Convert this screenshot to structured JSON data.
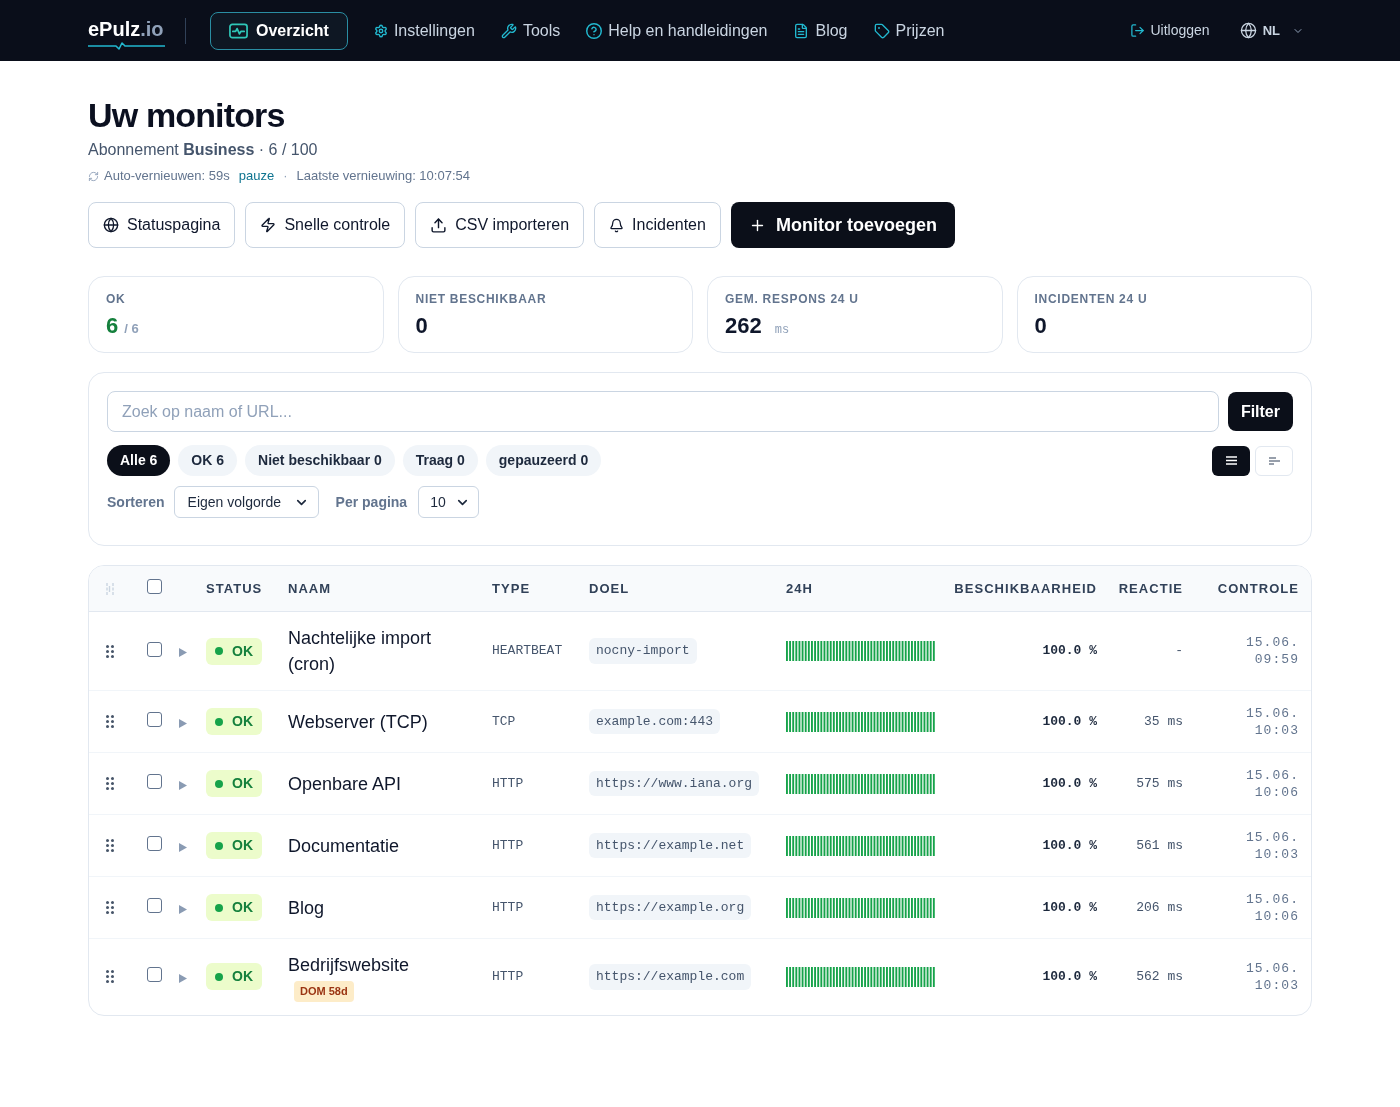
{
  "nav": {
    "logo": {
      "name": "ePulz",
      "domain": ".io"
    },
    "items": [
      {
        "label": "Overzicht",
        "selected": true
      },
      {
        "label": "Instellingen",
        "selected": false
      },
      {
        "label": "Tools",
        "selected": false
      },
      {
        "label": "Help en handleidingen",
        "selected": false
      },
      {
        "label": "Blog",
        "selected": false
      },
      {
        "label": "Prijzen",
        "selected": false
      }
    ],
    "logout": "Uitloggen",
    "language": "NL"
  },
  "header": {
    "title": "Uw monitors",
    "subscription": "Abonnement **Business** · 6 / 100",
    "auto_refresh": "Auto-vernieuwen: 59s",
    "pause_link": "pauze",
    "separator": "·",
    "last_refresh": "Laatste vernieuwing: 10:07:54"
  },
  "actions": [
    {
      "label": "Statuspagina",
      "kind": "outline"
    },
    {
      "label": "Snelle controle",
      "kind": "outline"
    },
    {
      "label": "CSV importeren",
      "kind": "outline"
    },
    {
      "label": "Incidenten",
      "kind": "outline"
    },
    {
      "label": "Monitor toevoegen",
      "kind": "primary"
    }
  ],
  "stats": [
    {
      "label": "OK",
      "value": "6",
      "suffix": "/ 6",
      "kind": "ratio"
    },
    {
      "label": "NIET BESCHIKBAAR",
      "value": "0",
      "kind": "plain"
    },
    {
      "label": "GEM. RESPONS 24 U",
      "value": "262",
      "suffix": "ms",
      "kind": "unit"
    },
    {
      "label": "INCIDENTEN 24 U",
      "value": "0",
      "kind": "plain"
    }
  ],
  "filters": {
    "search": {
      "placeholder": "Zoek op naam of URL..."
    },
    "filter_button": "Filter",
    "chips": [
      {
        "label": "Alle 6",
        "selected": true
      },
      {
        "label": "OK 6",
        "selected": false
      },
      {
        "label": "Niet beschikbaar 0",
        "selected": false
      },
      {
        "label": "Traag 0",
        "selected": false
      },
      {
        "label": "gepauzeerd 0",
        "selected": false
      }
    ],
    "views": [
      {
        "kind": "list",
        "selected": true
      },
      {
        "kind": "compact",
        "selected": false
      }
    ],
    "sort_label": "Sorteren",
    "sort_value": "Eigen volgorde",
    "per_page_label": "Per pagina",
    "per_page_value": "10"
  },
  "table": {
    "select_all_checked": false,
    "columns": [
      "STATUS",
      "NAAM",
      "TYPE",
      "DOEL",
      "24H",
      "BESCHIKBAARHEID",
      "REACTIE",
      "CONTROLE"
    ],
    "rows": [
      {
        "checked": false,
        "expanded": false,
        "status": "OK",
        "name": "Nachtelijke import (cron)",
        "type": "HEARTBEAT",
        "target": "nocny-import",
        "availability": "100.0 %",
        "response": "-",
        "checked_at": "15.06. 09:59"
      },
      {
        "checked": false,
        "expanded": false,
        "status": "OK",
        "name": "Webserver (TCP)",
        "type": "TCP",
        "target": "example.com:443",
        "availability": "100.0 %",
        "response": "35 ms",
        "checked_at": "15.06. 10:03"
      },
      {
        "checked": false,
        "expanded": false,
        "status": "OK",
        "name": "Openbare API",
        "type": "HTTP",
        "target": "https://www.iana.org",
        "availability": "100.0 %",
        "response": "575 ms",
        "checked_at": "15.06. 10:06"
      },
      {
        "checked": false,
        "expanded": false,
        "status": "OK",
        "name": "Documentatie",
        "type": "HTTP",
        "target": "https://example.net",
        "availability": "100.0 %",
        "response": "561 ms",
        "checked_at": "15.06. 10:03"
      },
      {
        "checked": false,
        "expanded": false,
        "status": "OK",
        "name": "Blog",
        "type": "HTTP",
        "target": "https://example.org",
        "availability": "100.0 %",
        "response": "206 ms",
        "checked_at": "15.06. 10:06"
      },
      {
        "checked": false,
        "expanded": false,
        "status": "OK",
        "name": "Bedrijfswebsite",
        "badge": "DOM 58d",
        "type": "HTTP",
        "target": "https://example.com",
        "availability": "100.0 %",
        "response": "562 ms",
        "checked_at": "15.06. 10:03"
      }
    ]
  }
}
